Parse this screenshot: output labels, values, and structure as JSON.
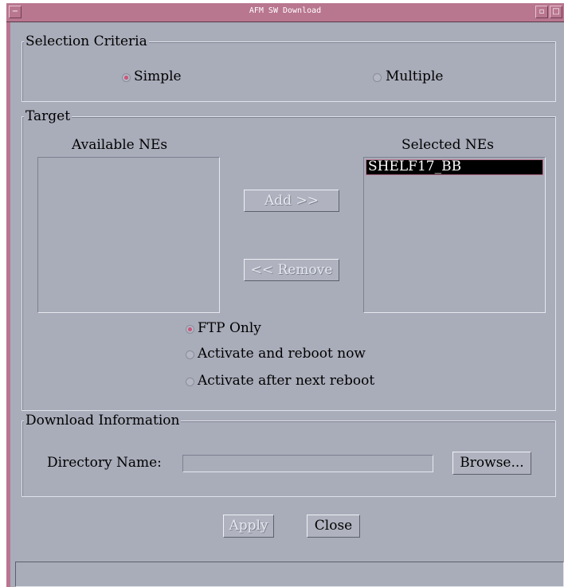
{
  "window": {
    "title": "AFM SW Download"
  },
  "selection_criteria": {
    "legend": "Selection Criteria",
    "options": [
      {
        "label": "Simple",
        "selected": true
      },
      {
        "label": "Multiple",
        "selected": false
      }
    ]
  },
  "target": {
    "legend": "Target",
    "available_label": "Available NEs",
    "available_items": [],
    "selected_label": "Selected NEs",
    "selected_items": [
      "SHELF17_BB"
    ],
    "add_button": "Add >>",
    "remove_button": "<< Remove",
    "modes": [
      {
        "label": "FTP Only",
        "selected": true
      },
      {
        "label": "Activate and reboot now",
        "selected": false
      },
      {
        "label": "Activate after next reboot",
        "selected": false
      }
    ]
  },
  "download_information": {
    "legend": "Download Information",
    "directory_label": "Directory Name:",
    "directory_value": "",
    "browse_button": "Browse..."
  },
  "actions": {
    "apply": "Apply",
    "close": "Close"
  },
  "status": {
    "text": ""
  },
  "colors": {
    "title_bar": "#b9768f",
    "background": "#a9acb9",
    "radio_selected": "#c9547a",
    "selection": "#000000"
  }
}
